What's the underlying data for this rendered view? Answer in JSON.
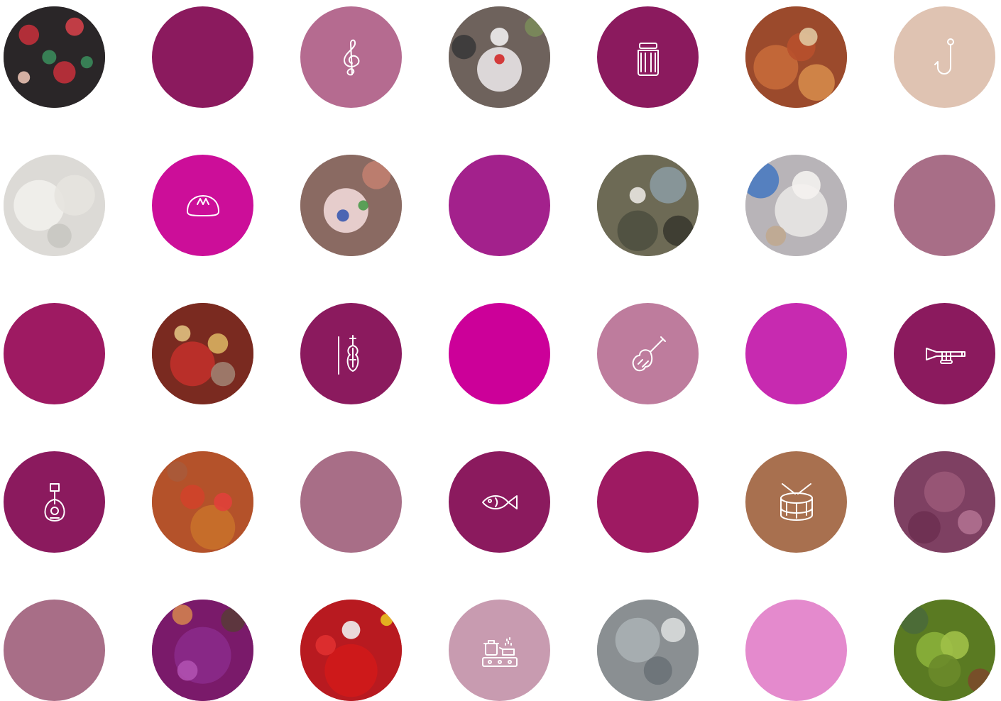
{
  "tiles": [
    {
      "kind": "photo",
      "scene": "embroidered-flower-shawl",
      "color": "#2a2628"
    },
    {
      "kind": "solid",
      "color": "#8b1a5e"
    },
    {
      "kind": "icon",
      "icon": "treble-clef-icon",
      "color": "#b56b90"
    },
    {
      "kind": "photo",
      "scene": "costumed-figure-white-dress",
      "color": "#6e625c"
    },
    {
      "kind": "icon",
      "icon": "jar-icon",
      "color": "#8b1a5e"
    },
    {
      "kind": "photo",
      "scene": "paella-wooden-spoon",
      "color": "#9b4a2c"
    },
    {
      "kind": "icon",
      "icon": "fishing-hook-icon",
      "color": "#dfc3b2"
    },
    {
      "kind": "photo",
      "scene": "white-lace-fringe",
      "color": "#dcdad6"
    },
    {
      "kind": "icon",
      "icon": "bread-icon",
      "color": "#cc0e99"
    },
    {
      "kind": "photo",
      "scene": "lace-glove-ring",
      "color": "#8a6a62"
    },
    {
      "kind": "solid",
      "color": "#a3218c"
    },
    {
      "kind": "photo",
      "scene": "man-fishing-rocks",
      "color": "#6d6a55"
    },
    {
      "kind": "photo",
      "scene": "white-veil-sky",
      "color": "#b8b4b8"
    },
    {
      "kind": "solid",
      "color": "#a86e87"
    },
    {
      "kind": "solid",
      "color": "#9e1a62"
    },
    {
      "kind": "photo",
      "scene": "jewelry-red-dress",
      "color": "#7a2a20"
    },
    {
      "kind": "icon",
      "icon": "violin-bow-icon",
      "color": "#8b1a5e"
    },
    {
      "kind": "solid",
      "color": "#cc0099"
    },
    {
      "kind": "icon",
      "icon": "cello-icon",
      "color": "#be7c9d"
    },
    {
      "kind": "solid",
      "color": "#c72ab0"
    },
    {
      "kind": "icon",
      "icon": "trumpet-icon",
      "color": "#8b1a5e"
    },
    {
      "kind": "icon",
      "icon": "lute-icon",
      "color": "#8b1a5e"
    },
    {
      "kind": "photo",
      "scene": "tomatoes-copper-bowl",
      "color": "#b4522a"
    },
    {
      "kind": "solid",
      "color": "#a86e87"
    },
    {
      "kind": "icon",
      "icon": "fish-icon",
      "color": "#8b1a5e"
    },
    {
      "kind": "solid",
      "color": "#9e1a62"
    },
    {
      "kind": "icon",
      "icon": "drum-icon",
      "color": "#a8704f"
    },
    {
      "kind": "photo",
      "scene": "tower-tinted-magenta",
      "color": "#7e4062"
    },
    {
      "kind": "solid",
      "color": "#a86e87"
    },
    {
      "kind": "photo",
      "scene": "purple-patterned-cloth",
      "color": "#7a1a6a"
    },
    {
      "kind": "photo",
      "scene": "red-costume-mask",
      "color": "#b81a20"
    },
    {
      "kind": "icon",
      "icon": "cooking-pots-stove-icon",
      "color": "#c89bb0"
    },
    {
      "kind": "photo",
      "scene": "net-fish-water",
      "color": "#8a8f92"
    },
    {
      "kind": "solid",
      "color": "#e48acd"
    },
    {
      "kind": "photo",
      "scene": "green-olives-basket",
      "color": "#5a7a22"
    }
  ]
}
